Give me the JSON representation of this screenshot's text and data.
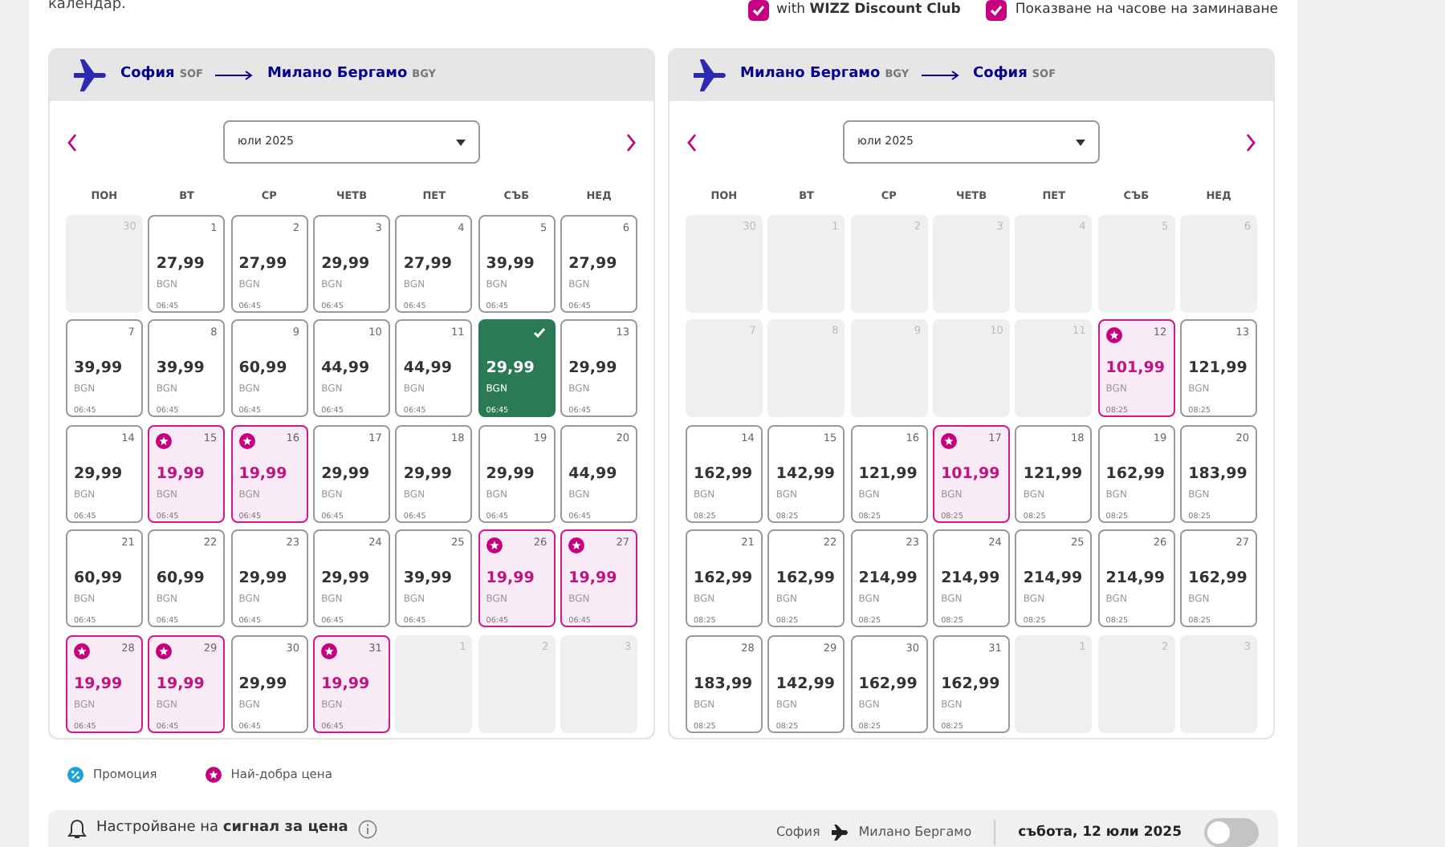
{
  "intro_text": "календар.",
  "options": [
    {
      "label": "with **WIZZ Discount Club**",
      "checked": true
    },
    {
      "label": "Показване на часове на заминаване",
      "checked": true
    }
  ],
  "calendars": [
    {
      "from_city": "София",
      "from_code": "SOF",
      "to_city": "Милано Бергамо",
      "to_code": "BGY",
      "month": "юли 2025",
      "weekdays": [
        "ПОН",
        "ВТ",
        "СР",
        "ЧЕТВ",
        "ПЕТ",
        "СЪБ",
        "НЕД"
      ],
      "days": [
        {
          "kind": "unavailable",
          "day": "30"
        },
        {
          "kind": "fare",
          "day": "1",
          "price": "27,99",
          "currency": "BGN",
          "time": "06:45",
          "best": false,
          "selected": false
        },
        {
          "kind": "fare",
          "day": "2",
          "price": "27,99",
          "currency": "BGN",
          "time": "06:45",
          "best": false,
          "selected": false
        },
        {
          "kind": "fare",
          "day": "3",
          "price": "29,99",
          "currency": "BGN",
          "time": "06:45",
          "best": false,
          "selected": false
        },
        {
          "kind": "fare",
          "day": "4",
          "price": "27,99",
          "currency": "BGN",
          "time": "06:45",
          "best": false,
          "selected": false
        },
        {
          "kind": "fare",
          "day": "5",
          "price": "39,99",
          "currency": "BGN",
          "time": "06:45",
          "best": false,
          "selected": false
        },
        {
          "kind": "fare",
          "day": "6",
          "price": "27,99",
          "currency": "BGN",
          "time": "06:45",
          "best": false,
          "selected": false
        },
        {
          "kind": "fare",
          "day": "7",
          "price": "39,99",
          "currency": "BGN",
          "time": "06:45",
          "best": false,
          "selected": false
        },
        {
          "kind": "fare",
          "day": "8",
          "price": "39,99",
          "currency": "BGN",
          "time": "06:45",
          "best": false,
          "selected": false
        },
        {
          "kind": "fare",
          "day": "9",
          "price": "60,99",
          "currency": "BGN",
          "time": "06:45",
          "best": false,
          "selected": false
        },
        {
          "kind": "fare",
          "day": "10",
          "price": "44,99",
          "currency": "BGN",
          "time": "06:45",
          "best": false,
          "selected": false
        },
        {
          "kind": "fare",
          "day": "11",
          "price": "44,99",
          "currency": "BGN",
          "time": "06:45",
          "best": false,
          "selected": false
        },
        {
          "kind": "fare",
          "price": "29,99",
          "currency": "BGN",
          "time": "06:45",
          "best": false,
          "selected": true
        },
        {
          "kind": "fare",
          "day": "13",
          "price": "29,99",
          "currency": "BGN",
          "time": "06:45",
          "best": false,
          "selected": false
        },
        {
          "kind": "fare",
          "day": "14",
          "price": "29,99",
          "currency": "BGN",
          "time": "06:45",
          "best": false,
          "selected": false
        },
        {
          "kind": "fare",
          "day": "15",
          "price": "19,99",
          "currency": "BGN",
          "time": "06:45",
          "best": true,
          "selected": false
        },
        {
          "kind": "fare",
          "day": "16",
          "price": "19,99",
          "currency": "BGN",
          "time": "06:45",
          "best": true,
          "selected": false
        },
        {
          "kind": "fare",
          "day": "17",
          "price": "29,99",
          "currency": "BGN",
          "time": "06:45",
          "best": false,
          "selected": false
        },
        {
          "kind": "fare",
          "day": "18",
          "price": "29,99",
          "currency": "BGN",
          "time": "06:45",
          "best": false,
          "selected": false
        },
        {
          "kind": "fare",
          "day": "19",
          "price": "29,99",
          "currency": "BGN",
          "time": "06:45",
          "best": false,
          "selected": false
        },
        {
          "kind": "fare",
          "day": "20",
          "price": "44,99",
          "currency": "BGN",
          "time": "06:45",
          "best": false,
          "selected": false
        },
        {
          "kind": "fare",
          "day": "21",
          "price": "60,99",
          "currency": "BGN",
          "time": "06:45",
          "best": false,
          "selected": false
        },
        {
          "kind": "fare",
          "day": "22",
          "price": "60,99",
          "currency": "BGN",
          "time": "06:45",
          "best": false,
          "selected": false
        },
        {
          "kind": "fare",
          "day": "23",
          "price": "29,99",
          "currency": "BGN",
          "time": "06:45",
          "best": false,
          "selected": false
        },
        {
          "kind": "fare",
          "day": "24",
          "price": "29,99",
          "currency": "BGN",
          "time": "06:45",
          "best": false,
          "selected": false
        },
        {
          "kind": "fare",
          "day": "25",
          "price": "39,99",
          "currency": "BGN",
          "time": "06:45",
          "best": false,
          "selected": false
        },
        {
          "kind": "fare",
          "day": "26",
          "price": "19,99",
          "currency": "BGN",
          "time": "06:45",
          "best": true,
          "selected": false
        },
        {
          "kind": "fare",
          "day": "27",
          "price": "19,99",
          "currency": "BGN",
          "time": "06:45",
          "best": true,
          "selected": false
        },
        {
          "kind": "fare",
          "day": "28",
          "price": "19,99",
          "currency": "BGN",
          "time": "06:45",
          "best": true,
          "selected": false
        },
        {
          "kind": "fare",
          "day": "29",
          "price": "19,99",
          "currency": "BGN",
          "time": "06:45",
          "best": true,
          "selected": false
        },
        {
          "kind": "fare",
          "day": "30",
          "price": "29,99",
          "currency": "BGN",
          "time": "06:45",
          "best": false,
          "selected": false
        },
        {
          "kind": "fare",
          "day": "31",
          "price": "19,99",
          "currency": "BGN",
          "time": "06:45",
          "best": true,
          "selected": false
        },
        {
          "kind": "unavailable",
          "day": "1"
        },
        {
          "kind": "unavailable",
          "day": "2"
        },
        {
          "kind": "unavailable",
          "day": "3"
        }
      ]
    },
    {
      "from_city": "Милано Бергамо",
      "from_code": "BGY",
      "to_city": "София",
      "to_code": "SOF",
      "month": "юли 2025",
      "weekdays": [
        "ПОН",
        "ВТ",
        "СР",
        "ЧЕТВ",
        "ПЕТ",
        "СЪБ",
        "НЕД"
      ],
      "days": [
        {
          "kind": "unavailable",
          "day": "30"
        },
        {
          "kind": "unavailable",
          "day": "1"
        },
        {
          "kind": "unavailable",
          "day": "2"
        },
        {
          "kind": "unavailable",
          "day": "3"
        },
        {
          "kind": "unavailable",
          "day": "4"
        },
        {
          "kind": "unavailable",
          "day": "5"
        },
        {
          "kind": "unavailable",
          "day": "6"
        },
        {
          "kind": "unavailable",
          "day": "7"
        },
        {
          "kind": "unavailable",
          "day": "8"
        },
        {
          "kind": "unavailable",
          "day": "9"
        },
        {
          "kind": "unavailable",
          "day": "10"
        },
        {
          "kind": "unavailable",
          "day": "11"
        },
        {
          "kind": "fare",
          "day": "12",
          "price": "101,99",
          "currency": "BGN",
          "time": "08:25",
          "best": true,
          "selected": false
        },
        {
          "kind": "fare",
          "day": "13",
          "price": "121,99",
          "currency": "BGN",
          "time": "08:25",
          "best": false,
          "selected": false
        },
        {
          "kind": "fare",
          "day": "14",
          "price": "162,99",
          "currency": "BGN",
          "time": "08:25",
          "best": false,
          "selected": false
        },
        {
          "kind": "fare",
          "day": "15",
          "price": "142,99",
          "currency": "BGN",
          "time": "08:25",
          "best": false,
          "selected": false
        },
        {
          "kind": "fare",
          "day": "16",
          "price": "121,99",
          "currency": "BGN",
          "time": "08:25",
          "best": false,
          "selected": false
        },
        {
          "kind": "fare",
          "day": "17",
          "price": "101,99",
          "currency": "BGN",
          "time": "08:25",
          "best": true,
          "selected": false
        },
        {
          "kind": "fare",
          "day": "18",
          "price": "121,99",
          "currency": "BGN",
          "time": "08:25",
          "best": false,
          "selected": false
        },
        {
          "kind": "fare",
          "day": "19",
          "price": "162,99",
          "currency": "BGN",
          "time": "08:25",
          "best": false,
          "selected": false
        },
        {
          "kind": "fare",
          "day": "20",
          "price": "183,99",
          "currency": "BGN",
          "time": "08:25",
          "best": false,
          "selected": false
        },
        {
          "kind": "fare",
          "day": "21",
          "price": "162,99",
          "currency": "BGN",
          "time": "08:25",
          "best": false,
          "selected": false
        },
        {
          "kind": "fare",
          "day": "22",
          "price": "162,99",
          "currency": "BGN",
          "time": "08:25",
          "best": false,
          "selected": false
        },
        {
          "kind": "fare",
          "day": "23",
          "price": "214,99",
          "currency": "BGN",
          "time": "08:25",
          "best": false,
          "selected": false
        },
        {
          "kind": "fare",
          "day": "24",
          "price": "214,99",
          "currency": "BGN",
          "time": "08:25",
          "best": false,
          "selected": false
        },
        {
          "kind": "fare",
          "day": "25",
          "price": "214,99",
          "currency": "BGN",
          "time": "08:25",
          "best": false,
          "selected": false
        },
        {
          "kind": "fare",
          "day": "26",
          "price": "214,99",
          "currency": "BGN",
          "time": "08:25",
          "best": false,
          "selected": false
        },
        {
          "kind": "fare",
          "day": "27",
          "price": "162,99",
          "currency": "BGN",
          "time": "08:25",
          "best": false,
          "selected": false
        },
        {
          "kind": "fare",
          "day": "28",
          "price": "183,99",
          "currency": "BGN",
          "time": "08:25",
          "best": false,
          "selected": false
        },
        {
          "kind": "fare",
          "day": "29",
          "price": "142,99",
          "currency": "BGN",
          "time": "08:25",
          "best": false,
          "selected": false
        },
        {
          "kind": "fare",
          "day": "30",
          "price": "162,99",
          "currency": "BGN",
          "time": "08:25",
          "best": false,
          "selected": false
        },
        {
          "kind": "fare",
          "day": "31",
          "price": "162,99",
          "currency": "BGN",
          "time": "08:25",
          "best": false,
          "selected": false
        },
        {
          "kind": "unavailable",
          "day": "1"
        },
        {
          "kind": "unavailable",
          "day": "2"
        },
        {
          "kind": "unavailable",
          "day": "3"
        }
      ]
    }
  ],
  "legend": [
    {
      "kind": "promo",
      "label": "Промоция"
    },
    {
      "kind": "best",
      "label": "Най-добра цена"
    }
  ],
  "price_alert": {
    "label": "Настройване на **сигнал за цена**",
    "from_city": "София",
    "to_city": "Милано Бергамо",
    "date": "събота, 12 юли 2025",
    "on": false
  }
}
